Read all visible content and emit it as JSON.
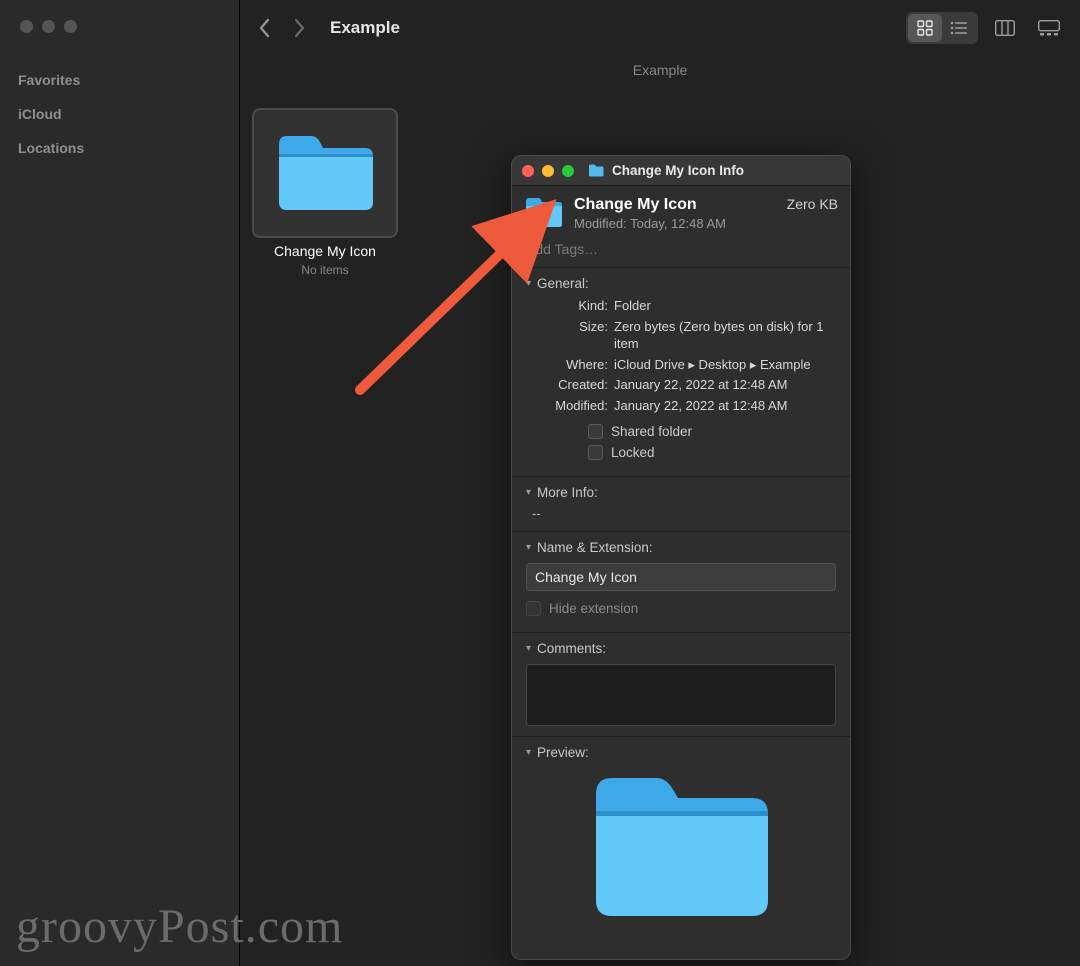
{
  "sidebar": {
    "headings": [
      "Favorites",
      "iCloud",
      "Locations"
    ]
  },
  "toolbar": {
    "title": "Example",
    "path": "Example"
  },
  "content": {
    "folder": {
      "name": "Change My Icon",
      "subtitle": "No items"
    }
  },
  "info": {
    "title": "Change My Icon Info",
    "name": "Change My Icon",
    "size_display": "Zero KB",
    "modified_short": "Modified: Today, 12:48 AM",
    "tags_placeholder": "Add Tags…",
    "general_label": "General:",
    "general": {
      "kind_label": "Kind:",
      "kind": "Folder",
      "size_label": "Size:",
      "size": "Zero bytes (Zero bytes on disk) for 1 item",
      "where_label": "Where:",
      "where": "iCloud Drive ▸ Desktop ▸ Example",
      "created_label": "Created:",
      "created": "January 22, 2022 at 12:48 AM",
      "modified_label": "Modified:",
      "modified": "January 22, 2022 at 12:48 AM",
      "shared_label": "Shared folder",
      "locked_label": "Locked"
    },
    "more_info_label": "More Info:",
    "more_info_value": "--",
    "name_ext_label": "Name & Extension:",
    "name_field_value": "Change My Icon",
    "hide_ext_label": "Hide extension",
    "comments_label": "Comments:",
    "preview_label": "Preview:"
  },
  "watermark": "groovyPost.com"
}
